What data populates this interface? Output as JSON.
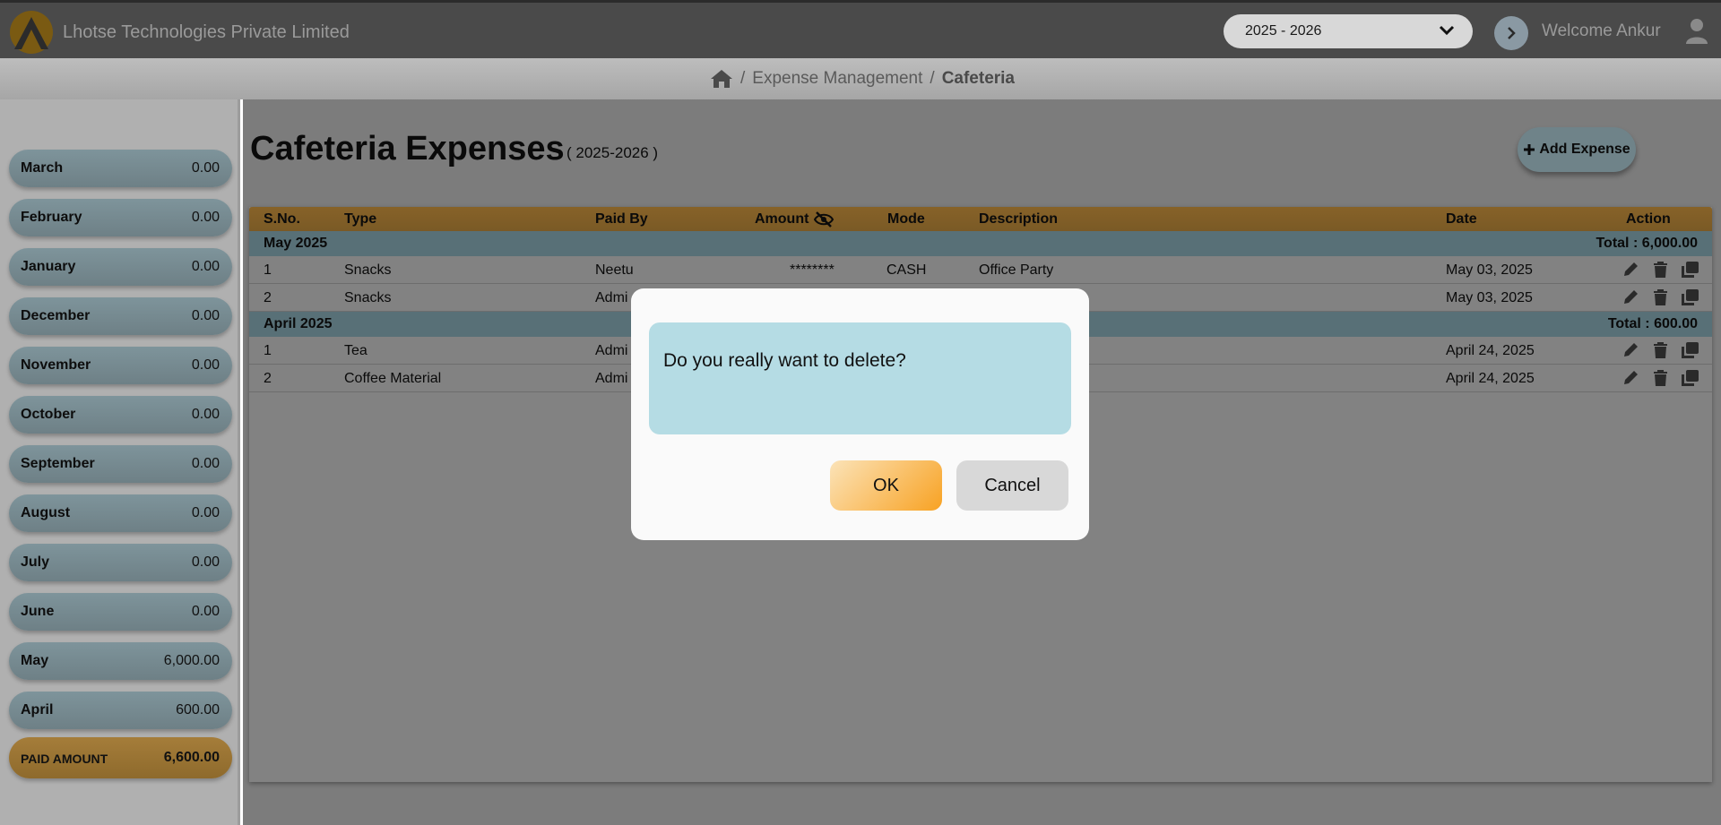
{
  "header": {
    "company": "Lhotse Technologies Private Limited",
    "fiscal_year": "2025 - 2026",
    "welcome": "Welcome Ankur"
  },
  "breadcrumb": {
    "section": "Expense Management",
    "current": "Cafeteria",
    "separator": "/"
  },
  "sidebar": {
    "months": [
      {
        "name": "March",
        "value": "0.00"
      },
      {
        "name": "February",
        "value": "0.00"
      },
      {
        "name": "January",
        "value": "0.00"
      },
      {
        "name": "December",
        "value": "0.00"
      },
      {
        "name": "November",
        "value": "0.00"
      },
      {
        "name": "October",
        "value": "0.00"
      },
      {
        "name": "September",
        "value": "0.00"
      },
      {
        "name": "August",
        "value": "0.00"
      },
      {
        "name": "July",
        "value": "0.00"
      },
      {
        "name": "June",
        "value": "0.00"
      },
      {
        "name": "May",
        "value": "6,000.00"
      },
      {
        "name": "April",
        "value": "600.00"
      }
    ],
    "paid_label": "PAID AMOUNT",
    "paid_value": "6,600.00"
  },
  "main": {
    "title": "Cafeteria Expenses",
    "subtitle": "( 2025-2026 )",
    "add_button": "Add Expense"
  },
  "table": {
    "headers": {
      "sno": "S.No.",
      "type": "Type",
      "paid_by": "Paid By",
      "amount": "Amount",
      "mode": "Mode",
      "description": "Description",
      "date": "Date",
      "action": "Action"
    },
    "groups": [
      {
        "name": "May 2025",
        "total": "Total : 6,000.00",
        "rows": [
          {
            "sno": "1",
            "type": "Snacks",
            "paid_by": "Neetu",
            "amount": "********",
            "mode": "CASH",
            "description": "Office Party",
            "date": "May 03, 2025"
          },
          {
            "sno": "2",
            "type": "Snacks",
            "paid_by": "Admi",
            "amount": "",
            "mode": "",
            "description": "",
            "date": "May 03, 2025"
          }
        ]
      },
      {
        "name": "April 2025",
        "total": "Total : 600.00",
        "rows": [
          {
            "sno": "1",
            "type": "Tea",
            "paid_by": "Admi",
            "amount": "",
            "mode": "",
            "description": "",
            "date": "April 24, 2025"
          },
          {
            "sno": "2",
            "type": "Coffee Material",
            "paid_by": "Admi",
            "amount": "",
            "mode": "",
            "description": "",
            "date": "April 24, 2025"
          }
        ]
      }
    ]
  },
  "dialog": {
    "message": "Do you really want to delete?",
    "ok": "OK",
    "cancel": "Cancel"
  },
  "colors": {
    "accent_orange": "#f8a223",
    "dialog_message_bg": "#b5dce4",
    "topbar": "#4a4a4a"
  }
}
